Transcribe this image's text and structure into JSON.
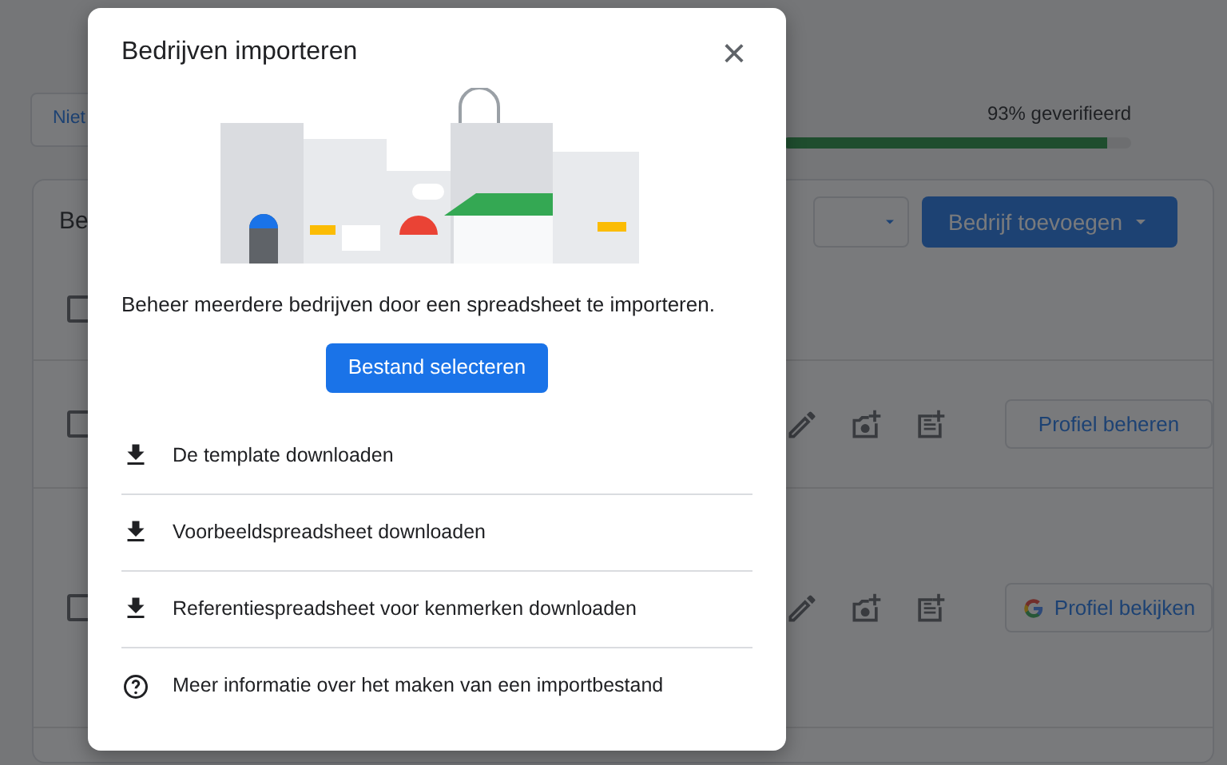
{
  "page": {
    "filter_button": "Niet",
    "verification": {
      "label": "93% geverifieerd",
      "level": 0.93
    },
    "card": {
      "title": "Be",
      "add_button": "Bedrijf toevoegen",
      "rows": [
        {
          "checked": false,
          "profile_button": "Profiel beheren",
          "google": false
        },
        {
          "checked": false,
          "profile_button": "Profiel bekijken",
          "google": true
        }
      ],
      "select_all_checked": false
    }
  },
  "dialog": {
    "title": "Bedrijven importeren",
    "close": "×",
    "description": "Beheer meerdere bedrijven door een spreadsheet te importeren.",
    "primary_button": "Bestand selecteren",
    "links": [
      {
        "kind": "download",
        "label": "De template downloaden"
      },
      {
        "kind": "download",
        "label": "Voorbeeldspreadsheet downloaden"
      },
      {
        "kind": "download",
        "label": "Referentiespreadsheet voor kenmerken downloaden"
      },
      {
        "kind": "help",
        "label": "Meer informatie over het maken van een importbestand"
      }
    ]
  }
}
